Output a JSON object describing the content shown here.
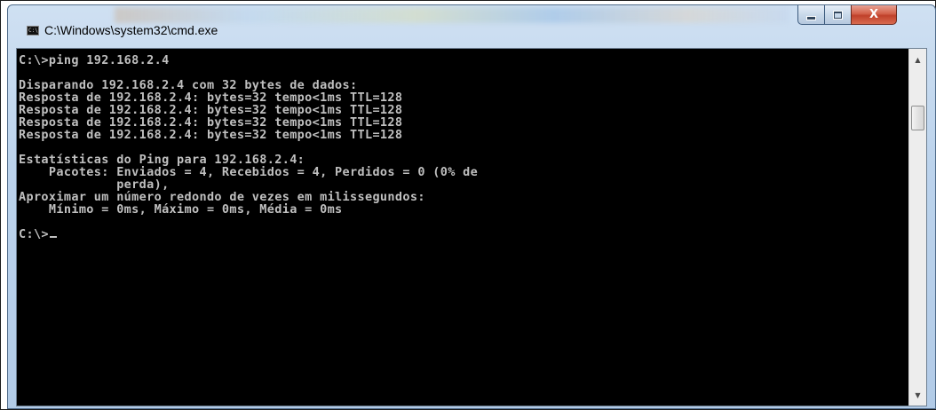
{
  "window": {
    "title": "C:\\Windows\\system32\\cmd.exe",
    "icon": "cmd-console-icon",
    "icon_text": "C:\\",
    "controls": {
      "minimize_icon": "minimize-icon",
      "maximize_icon": "maximize-icon",
      "close_icon": "close-icon",
      "close_glyph": "X"
    }
  },
  "colors": {
    "console_background": "#000000",
    "console_text": "#c0c0c0",
    "close_button": "#c9452e"
  },
  "console": {
    "lines": [
      "C:\\>ping 192.168.2.4",
      "",
      "Disparando 192.168.2.4 com 32 bytes de dados:",
      "Resposta de 192.168.2.4: bytes=32 tempo<1ms TTL=128",
      "Resposta de 192.168.2.4: bytes=32 tempo<1ms TTL=128",
      "Resposta de 192.168.2.4: bytes=32 tempo<1ms TTL=128",
      "Resposta de 192.168.2.4: bytes=32 tempo<1ms TTL=128",
      "",
      "Estatísticas do Ping para 192.168.2.4:",
      "    Pacotes: Enviados = 4, Recebidos = 4, Perdidos = 0 (0% de",
      "             perda),",
      "Aproximar um número redondo de vezes em milissegundos:",
      "    Mínimo = 0ms, Máximo = 0ms, Média = 0ms",
      "",
      "C:\\>"
    ]
  },
  "scrollbar": {
    "up_icon": "scroll-up-arrow-icon",
    "down_icon": "scroll-down-arrow-icon"
  }
}
